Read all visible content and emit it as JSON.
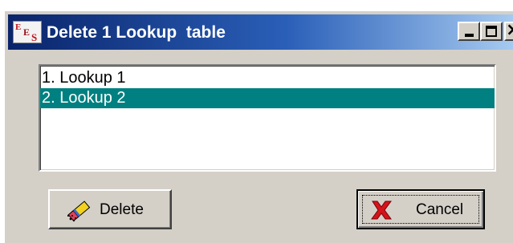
{
  "window": {
    "title": "Delete 1 Lookup  table",
    "app_icon": "EES-logo-icon",
    "controls": {
      "minimize": "minimize-icon",
      "maximize": "maximize-icon",
      "close": "close-icon"
    }
  },
  "list": {
    "items": [
      {
        "label": "1. Lookup 1",
        "selected": false
      },
      {
        "label": "2. Lookup 2",
        "selected": true
      }
    ],
    "selection_color": "#008080"
  },
  "buttons": {
    "delete": {
      "label": "Delete",
      "icon": "eraser-icon"
    },
    "cancel": {
      "label": "Cancel",
      "icon": "red-x-icon"
    }
  },
  "colors": {
    "titlebar_start": "#0a246a",
    "titlebar_end": "#a6caf0",
    "face": "#d4d0c8"
  }
}
